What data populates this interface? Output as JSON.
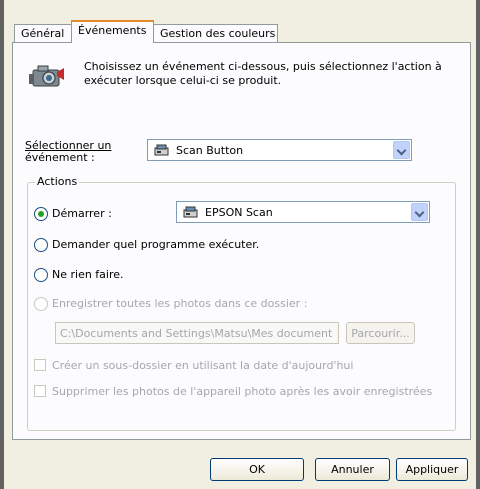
{
  "tabs": [
    "Général",
    "Événements",
    "Gestion des couleurs"
  ],
  "intro_text": "Choisissez un événement ci-dessous, puis sélectionnez l'action à exécuter lorsque celui-ci se produit.",
  "event": {
    "label_line1": "Sélectionner un",
    "label_line2": "événement :",
    "value": "Scan Button"
  },
  "actions": {
    "title": "Actions",
    "start_label": "Démarrer :",
    "start_program": "EPSON Scan",
    "ask_label": "Demander quel programme exécuter.",
    "nothing_label": "Ne rien faire.",
    "save_label": "Enregistrer toutes les photos dans ce dossier :",
    "folder_path": "C:\\Documents and Settings\\Matsu\\Mes document",
    "browse_label": "Parcourir...",
    "subfolder_label": "Créer un sous-dossier en utilisant la date d'aujourd'hui",
    "delete_label": "Supprimer les photos de l'appareil photo après les avoir enregistrées"
  },
  "buttons": {
    "ok": "OK",
    "cancel": "Annuler",
    "apply": "Appliquer"
  }
}
